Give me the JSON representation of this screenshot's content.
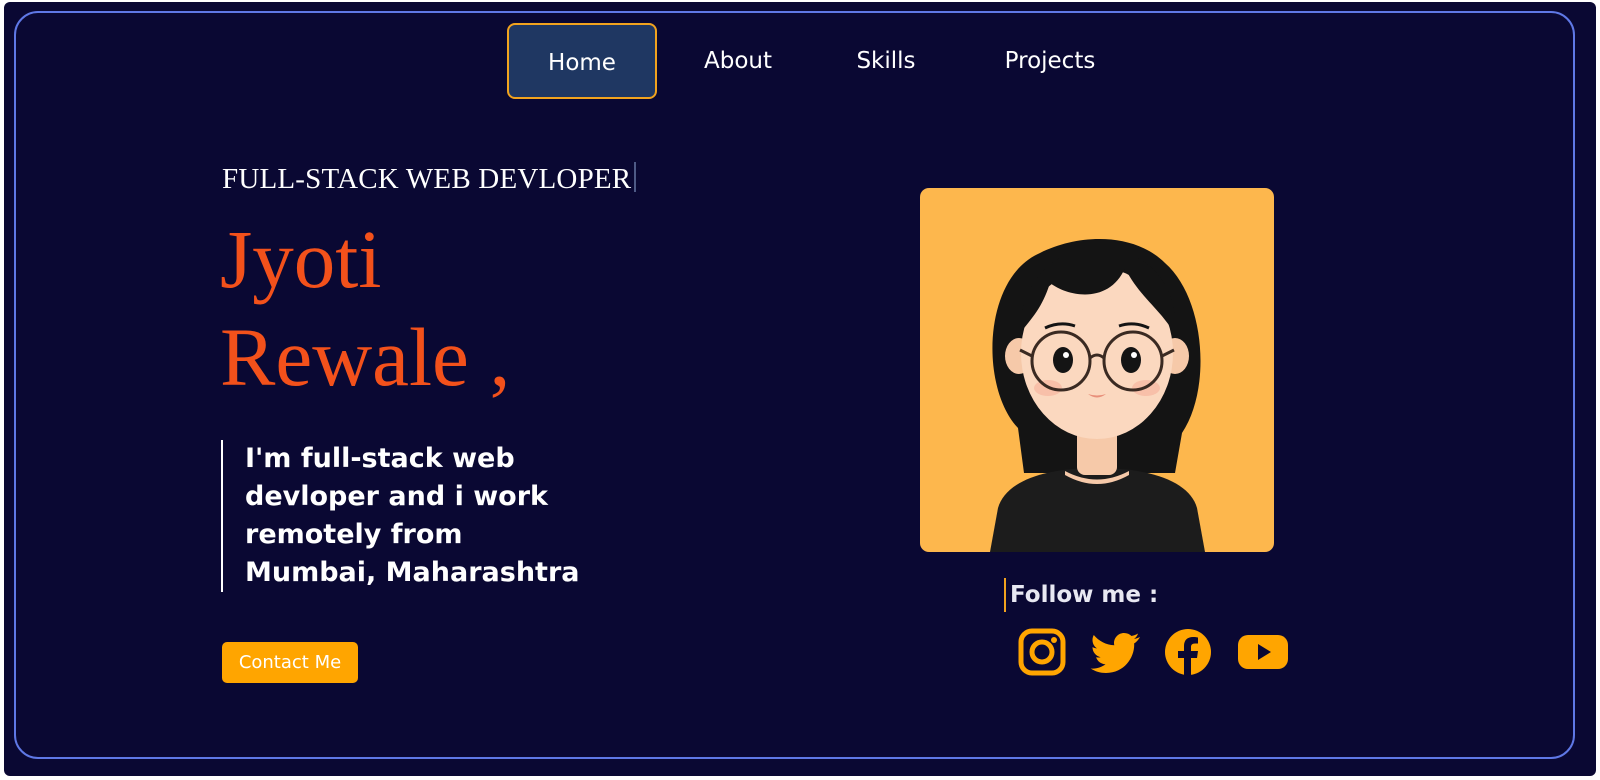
{
  "nav": {
    "items": [
      {
        "label": "Home",
        "active": true
      },
      {
        "label": "About"
      },
      {
        "label": "Skills"
      },
      {
        "label": "Projects"
      }
    ]
  },
  "hero": {
    "subtitle": "FULL-STACK WEB DEVLOPER",
    "name_line1": "Jyoti",
    "name_line2": "Rewale ,",
    "bio": "I'm full-stack web devloper and i work remotely from Mumbai, Maharashtra",
    "contact_label": "Contact Me"
  },
  "follow": {
    "label": "Follow me :",
    "icons": [
      "instagram-icon",
      "twitter-icon",
      "facebook-icon",
      "youtube-icon"
    ]
  },
  "colors": {
    "background": "#0a0833",
    "frame_border": "#5f78e6",
    "accent": "#ffa500",
    "name": "#f3511b",
    "nav_active_bg": "#1f3762",
    "avatar_bg": "#fdb74d"
  }
}
